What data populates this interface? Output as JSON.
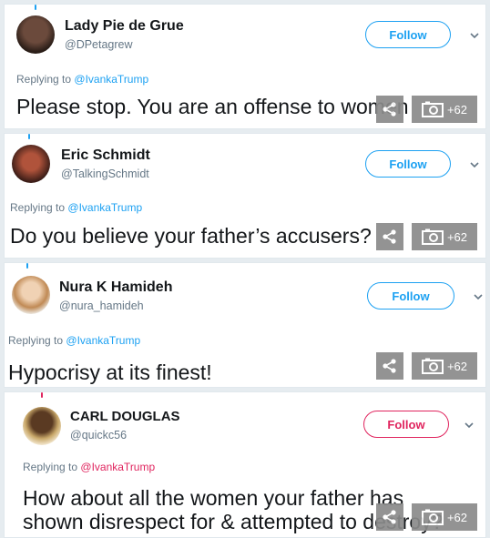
{
  "tweets": [
    {
      "name": "Lady Pie de Grue",
      "handle": "@DPetagrew",
      "follow_label": "Follow",
      "replying_prefix": "Replying to",
      "replying_to": "@IvankaTrump",
      "text": "Please stop. You are an offense to women",
      "avatar_color": "#3a2a24",
      "thread_color": "#1da1f2"
    },
    {
      "name": "Eric Schmidt",
      "handle": "@TalkingSchmidt",
      "follow_label": "Follow",
      "replying_prefix": "Replying to",
      "replying_to": "@IvankaTrump",
      "text": "Do you believe your father’s accusers?",
      "avatar_color": "#5a2a20",
      "thread_color": "#1da1f2"
    },
    {
      "name": "Nura K Hamideh",
      "handle": "@nura_hamideh",
      "follow_label": "Follow",
      "replying_prefix": "Replying to",
      "replying_to": "@IvankaTrump",
      "text": "Hypocrisy at its finest!",
      "avatar_color": "#c9a27a",
      "thread_color": "#1da1f2"
    },
    {
      "name": "CARL DOUGLAS",
      "handle": "@quickc56",
      "follow_label": "Follow",
      "replying_prefix": "Replying to",
      "replying_to": "@IvankaTrump",
      "text_line1": "How about all the women your father has",
      "text_line2": "shown disrespect for & attempted to destroy?",
      "avatar_color": "#4a3322",
      "thread_color": "#e0245e"
    }
  ],
  "overlay": {
    "photo_count": "+62",
    "share_icon": "share-icon",
    "camera_icon": "camera-icon"
  },
  "colors": {
    "accent_blue": "#1da1f2",
    "accent_red": "#e0245e",
    "overlay_gray": "#8a8a8a"
  }
}
